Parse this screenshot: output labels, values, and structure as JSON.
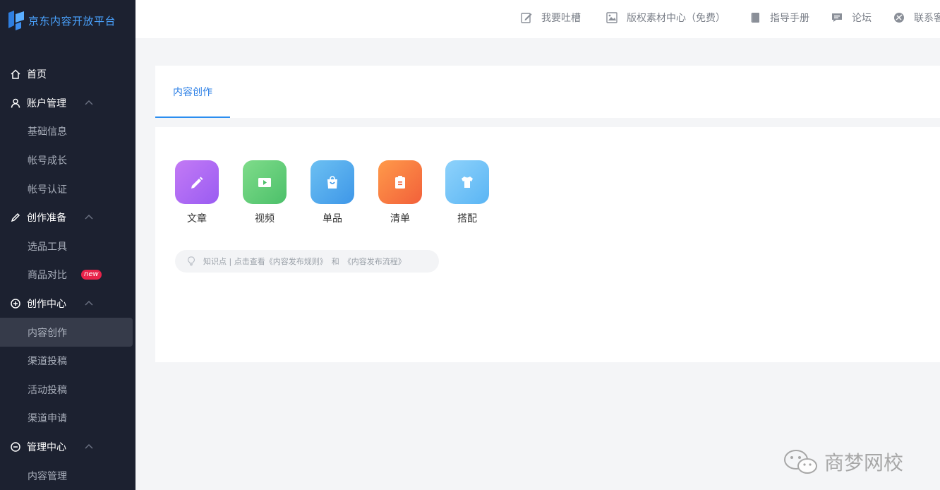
{
  "app": {
    "logo_text": "京东内容开放平台"
  },
  "sidebar": {
    "menu": [
      {
        "type": "group",
        "label": "首页",
        "icon": "home-icon",
        "expandable": false
      },
      {
        "type": "group",
        "label": "账户管理",
        "icon": "user-icon",
        "expandable": true
      },
      {
        "type": "item",
        "label": "基础信息"
      },
      {
        "type": "item",
        "label": "帐号成长"
      },
      {
        "type": "item",
        "label": "帐号认证"
      },
      {
        "type": "group",
        "label": "创作准备",
        "icon": "pencil-icon",
        "expandable": true
      },
      {
        "type": "item",
        "label": "选品工具"
      },
      {
        "type": "item",
        "label": "商品对比",
        "badge": "new"
      },
      {
        "type": "group",
        "label": "创作中心",
        "icon": "plus-circle-icon",
        "expandable": true
      },
      {
        "type": "item",
        "label": "内容创作",
        "active": true
      },
      {
        "type": "item",
        "label": "渠道投稿"
      },
      {
        "type": "item",
        "label": "活动投稿"
      },
      {
        "type": "item",
        "label": "渠道申请"
      },
      {
        "type": "group",
        "label": "管理中心",
        "icon": "minus-circle-icon",
        "expandable": true
      },
      {
        "type": "item",
        "label": "内容管理"
      }
    ]
  },
  "topbar": {
    "links": [
      {
        "label": "我要吐槽",
        "icon": "edit-icon"
      },
      {
        "label": "版权素材中心（免费）",
        "icon": "image-icon"
      },
      {
        "label": "指导手册",
        "icon": "book-icon"
      },
      {
        "label": "论坛",
        "icon": "chat-icon"
      },
      {
        "label": "联系客",
        "icon": "contact-icon"
      }
    ]
  },
  "tabs": [
    {
      "label": "内容创作",
      "active": true
    }
  ],
  "tools": [
    {
      "label": "文章",
      "icon": "pencil-icon",
      "gradient": [
        "#c37af5",
        "#9a5cf2"
      ]
    },
    {
      "label": "视频",
      "icon": "video-icon",
      "gradient": [
        "#7fdc8a",
        "#4cc06a"
      ]
    },
    {
      "label": "单品",
      "icon": "bag-icon",
      "gradient": [
        "#6cc0f2",
        "#3e97e8"
      ]
    },
    {
      "label": "清单",
      "icon": "clipboard-icon",
      "gradient": [
        "#ff9a4a",
        "#f2603a"
      ]
    },
    {
      "label": "搭配",
      "icon": "shirt-icon",
      "gradient": [
        "#8ed2fb",
        "#5ab5f4"
      ]
    }
  ],
  "tip": {
    "prefix": "知识点 | 点击查看",
    "link1": "《内容发布规则》",
    "conjunction": "和",
    "link2": "《内容发布流程》"
  },
  "watermark": {
    "text": "商梦网校"
  },
  "colors": {
    "sidebar_bg": "#1c2130",
    "accent": "#2b7fe6",
    "badge": "#e8234a"
  }
}
